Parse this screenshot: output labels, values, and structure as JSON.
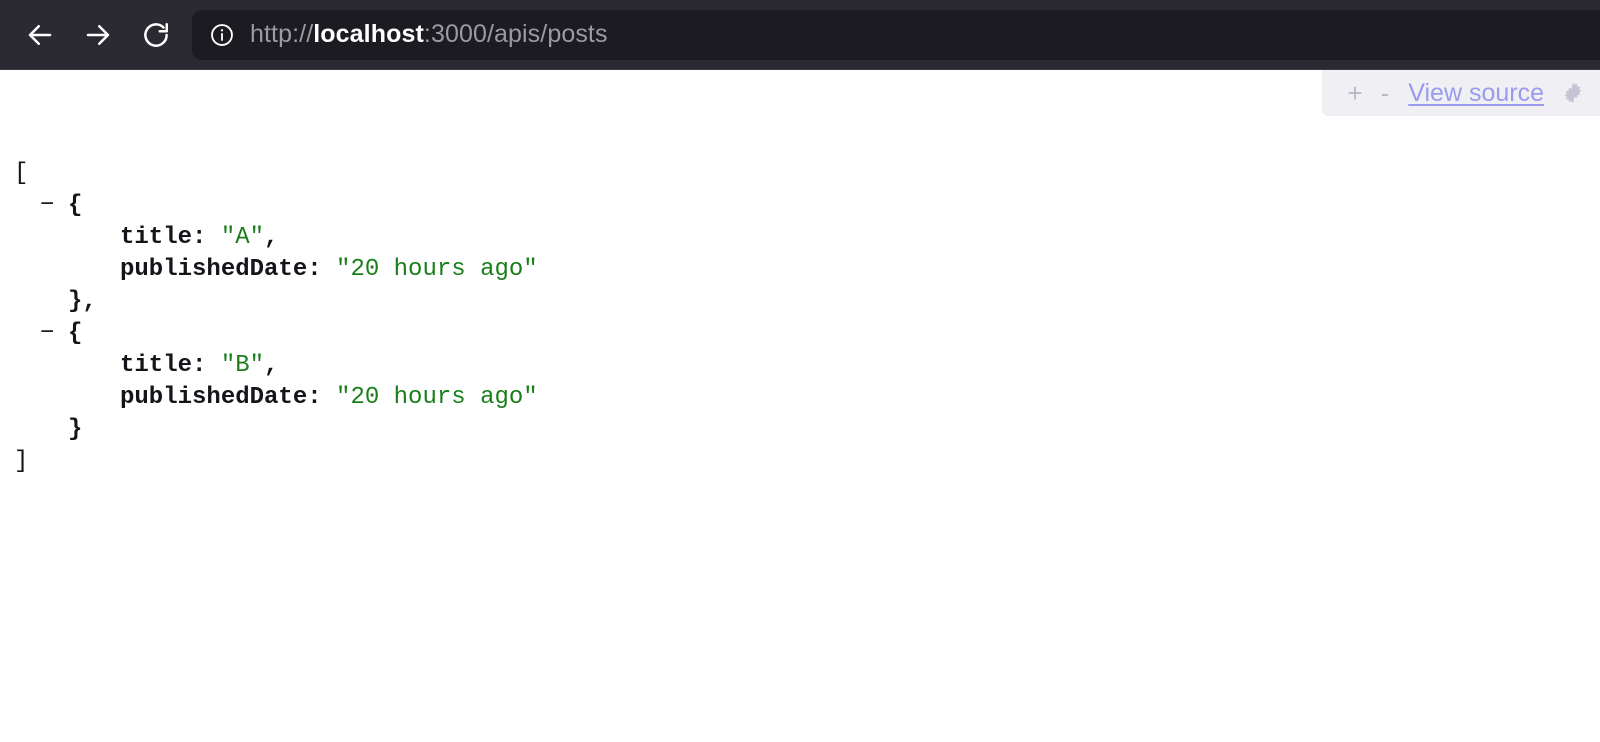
{
  "browser": {
    "back_label": "Back",
    "forward_label": "Forward",
    "reload_label": "Reload",
    "icons": {
      "back": "arrow-left-icon",
      "forward": "arrow-right-icon",
      "reload": "reload-icon",
      "identity": "info-circle-icon",
      "gear": "gear-icon"
    },
    "url": {
      "full": "http://localhost:3000/apis/posts",
      "scheme": "http://",
      "host": "localhost",
      "rest": ":3000/apis/posts"
    },
    "colors": {
      "chrome_bg": "#2b2a33",
      "urlbar_bg": "#1c1b22",
      "url_dim": "#9a9aa4",
      "url_host": "#ffffff"
    }
  },
  "json_viewer": {
    "toolbar": {
      "expand_label": "+",
      "collapse_label": "-",
      "view_source_label": "View source",
      "gear_title": "Settings",
      "bg_color": "#f0f0f4",
      "link_color": "#9a9aee"
    },
    "colors": {
      "string_value": "#1a7f1a",
      "key": "#15141a",
      "punctuation": "#15141a",
      "page_bg": "#ffffff"
    },
    "tree": {
      "open_bracket": "[",
      "close_bracket": "]",
      "collapse_toggle": "−",
      "open_brace": "{",
      "close_brace_comma": "},",
      "close_brace": "}",
      "comma": ",",
      "colon": ":",
      "items": [
        {
          "title_key": "title",
          "title_value": "\"A\"",
          "date_key": "publishedDate",
          "date_value": "\"20 hours ago\""
        },
        {
          "title_key": "title",
          "title_value": "\"B\"",
          "date_key": "publishedDate",
          "date_value": "\"20 hours ago\""
        }
      ]
    }
  }
}
